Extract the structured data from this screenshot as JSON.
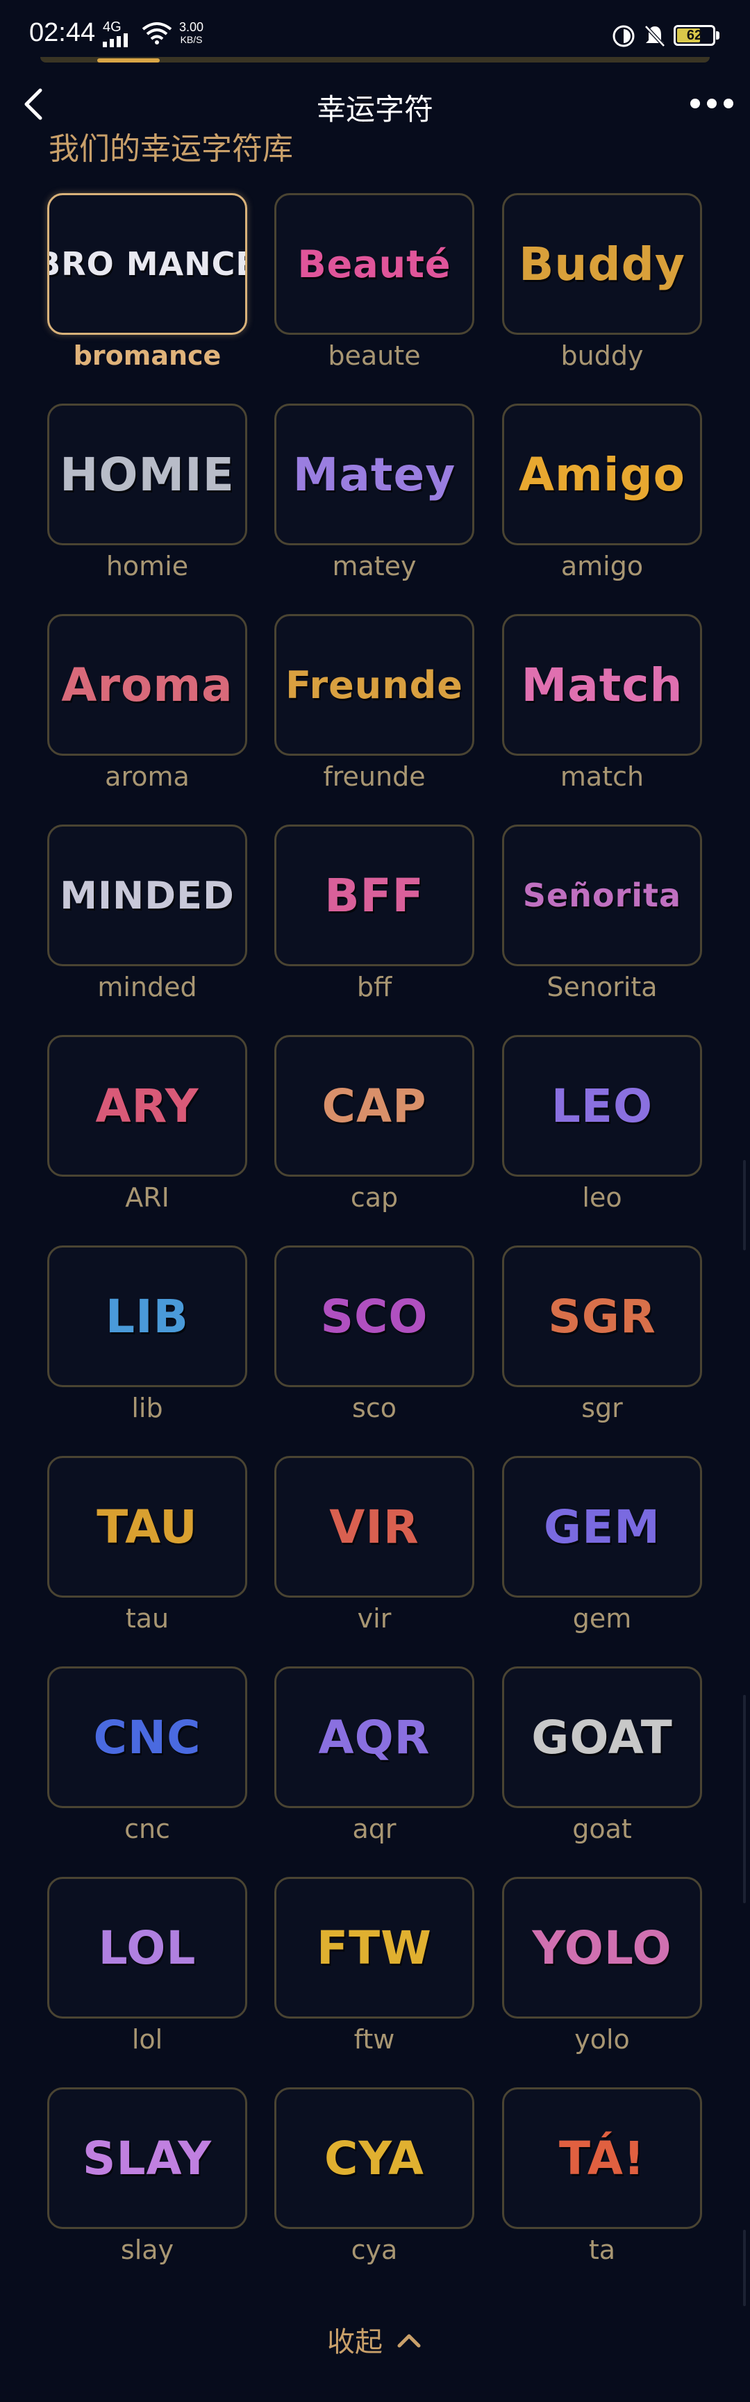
{
  "status": {
    "time": "02:44",
    "network": "4G",
    "speed_value": "3.00",
    "speed_unit": "KB/S",
    "battery": "62"
  },
  "header": {
    "title": "幸运字符",
    "back_icon": "chevron-left-icon",
    "more_icon": "more-dots-icon"
  },
  "section": {
    "title": "我们的幸运字符库"
  },
  "characters": [
    {
      "logo": "BRO MANCE",
      "label": "bromance",
      "selected": true,
      "color": "#e8e8f0"
    },
    {
      "logo": "Beauté",
      "label": "beaute",
      "selected": false,
      "color": "#e0559a"
    },
    {
      "logo": "Buddy",
      "label": "buddy",
      "selected": false,
      "color": "#d9a03a"
    },
    {
      "logo": "HOMIE",
      "label": "homie",
      "selected": false,
      "color": "#b8bcc8"
    },
    {
      "logo": "Matey",
      "label": "matey",
      "selected": false,
      "color": "#9a7ee0"
    },
    {
      "logo": "Amigo",
      "label": "amigo",
      "selected": false,
      "color": "#e8a830"
    },
    {
      "logo": "Aroma",
      "label": "aroma",
      "selected": false,
      "color": "#d96a7a"
    },
    {
      "logo": "Freunde",
      "label": "freunde",
      "selected": false,
      "color": "#d9a040"
    },
    {
      "logo": "Match",
      "label": "match",
      "selected": false,
      "color": "#e070b0"
    },
    {
      "logo": "MINDED",
      "label": "minded",
      "selected": false,
      "color": "#c8c8d8"
    },
    {
      "logo": "BFF",
      "label": "bff",
      "selected": false,
      "color": "#d9609a"
    },
    {
      "logo": "Señorita",
      "label": "Senorita",
      "selected": false,
      "color": "#c070c0"
    },
    {
      "logo": "ARY",
      "label": "ARI",
      "selected": false,
      "color": "#d95a78"
    },
    {
      "logo": "CAP",
      "label": "cap",
      "selected": false,
      "color": "#d9906a"
    },
    {
      "logo": "LEO",
      "label": "leo",
      "selected": false,
      "color": "#8a70e0"
    },
    {
      "logo": "LIB",
      "label": "lib",
      "selected": false,
      "color": "#4a9ad9"
    },
    {
      "logo": "SCO",
      "label": "sco",
      "selected": false,
      "color": "#b050c0"
    },
    {
      "logo": "SGR",
      "label": "sgr",
      "selected": false,
      "color": "#d9704a"
    },
    {
      "logo": "TAU",
      "label": "tau",
      "selected": false,
      "color": "#d9a030"
    },
    {
      "logo": "VIR",
      "label": "vir",
      "selected": false,
      "color": "#d96050"
    },
    {
      "logo": "GEM",
      "label": "gem",
      "selected": false,
      "color": "#7a6ae0"
    },
    {
      "logo": "CNC",
      "label": "cnc",
      "selected": false,
      "color": "#4a6ae0"
    },
    {
      "logo": "AQR",
      "label": "aqr",
      "selected": false,
      "color": "#8a70e0"
    },
    {
      "logo": "GOAT",
      "label": "goat",
      "selected": false,
      "color": "#c8c8c8"
    },
    {
      "logo": "LOL",
      "label": "lol",
      "selected": false,
      "color": "#b080e0"
    },
    {
      "logo": "FTW",
      "label": "ftw",
      "selected": false,
      "color": "#e0b030"
    },
    {
      "logo": "YOLO",
      "label": "yolo",
      "selected": false,
      "color": "#d070b0"
    },
    {
      "logo": "SLAY",
      "label": "slay",
      "selected": false,
      "color": "#c080e0"
    },
    {
      "logo": "CYA",
      "label": "cya",
      "selected": false,
      "color": "#e0b030"
    },
    {
      "logo": "TÁ!",
      "label": "ta",
      "selected": false,
      "color": "#e06040"
    }
  ],
  "footer": {
    "collapse_label": "收起",
    "collapse_icon": "chevron-up-icon"
  }
}
